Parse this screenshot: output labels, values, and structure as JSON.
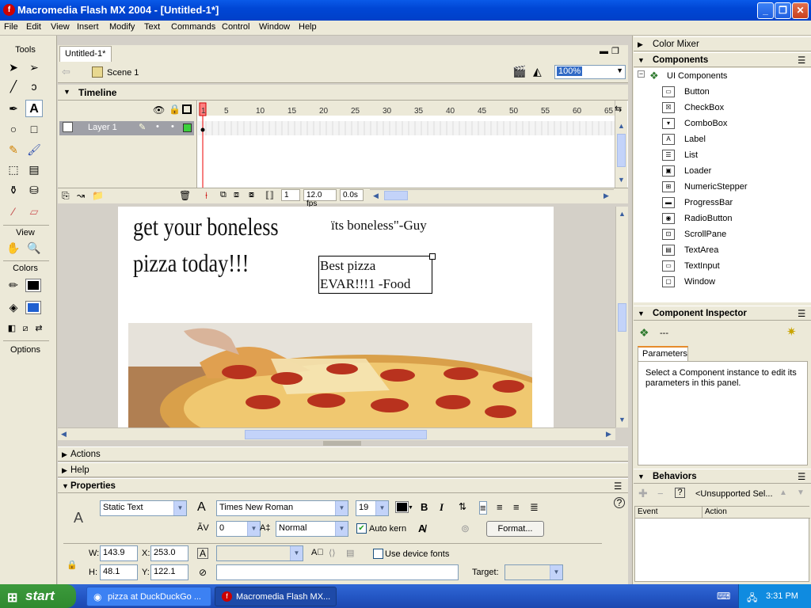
{
  "window": {
    "title": "Macromedia Flash MX 2004 - [Untitled-1*]"
  },
  "menu": [
    "File",
    "Edit",
    "View",
    "Insert",
    "Modify",
    "Text",
    "Commands",
    "Control",
    "Window",
    "Help"
  ],
  "tools": {
    "title": "Tools",
    "view_label": "View",
    "colors_label": "Colors",
    "options_label": "Options"
  },
  "doc": {
    "tab": "Untitled-1*",
    "scene": "Scene 1",
    "zoom": "100%"
  },
  "timeline": {
    "title": "Timeline",
    "layer": "Layer 1",
    "frame_numbers": [
      "1",
      "5",
      "10",
      "15",
      "20",
      "25",
      "30",
      "35",
      "40",
      "45",
      "50",
      "55",
      "60",
      "65"
    ],
    "current_frame": "1",
    "fps": "12.0 fps",
    "elapsed": "0.0s"
  },
  "stage": {
    "headline_1": "get your boneless",
    "headline_2": "pizza today!!!",
    "quote": "ïts boneless\"-Guy",
    "box_line_1": "Best pizza",
    "box_line_2": "EVAR!!!1 -Food"
  },
  "panels": {
    "actions": "Actions",
    "help": "Help",
    "properties": "Properties"
  },
  "properties": {
    "text_type": "Static Text",
    "font": "Times New Roman",
    "font_size": "19",
    "bold": "B",
    "italic": "I",
    "spacing": "0",
    "position_mode": "Normal",
    "auto_kern": "Auto kern",
    "format_button": "Format...",
    "use_device_fonts": "Use device fonts",
    "target_label": "Target:",
    "w_label": "W:",
    "w_value": "143.9",
    "x_label": "X:",
    "x_value": "253.0",
    "h_label": "H:",
    "h_value": "48.1",
    "y_label": "Y:",
    "y_value": "122.1"
  },
  "right": {
    "color_mixer": "Color Mixer",
    "components": "Components",
    "ui_components": "UI Components",
    "component_list": [
      "Button",
      "CheckBox",
      "ComboBox",
      "Label",
      "List",
      "Loader",
      "NumericStepper",
      "ProgressBar",
      "RadioButton",
      "ScrollPane",
      "TextArea",
      "TextInput",
      "Window"
    ],
    "inspector": "Component Inspector",
    "inspector_dash": "---",
    "parameters_tab": "Parameters",
    "inspector_msg": "Select a Component instance to edit its parameters in this panel.",
    "behaviors": "Behaviors",
    "behaviors_sel": "<Unsupported Sel...",
    "event_col": "Event",
    "action_col": "Action"
  },
  "taskbar": {
    "start": "start",
    "task1": "pizza at DuckDuckGo ...",
    "task2": "Macromedia Flash MX...",
    "time": "3:31 PM"
  },
  "colors": {
    "titlebar": "#0046d5",
    "stroke_color": "#000000",
    "fill_color": "#1f5fd0",
    "selected_frame": "#ff8080"
  }
}
